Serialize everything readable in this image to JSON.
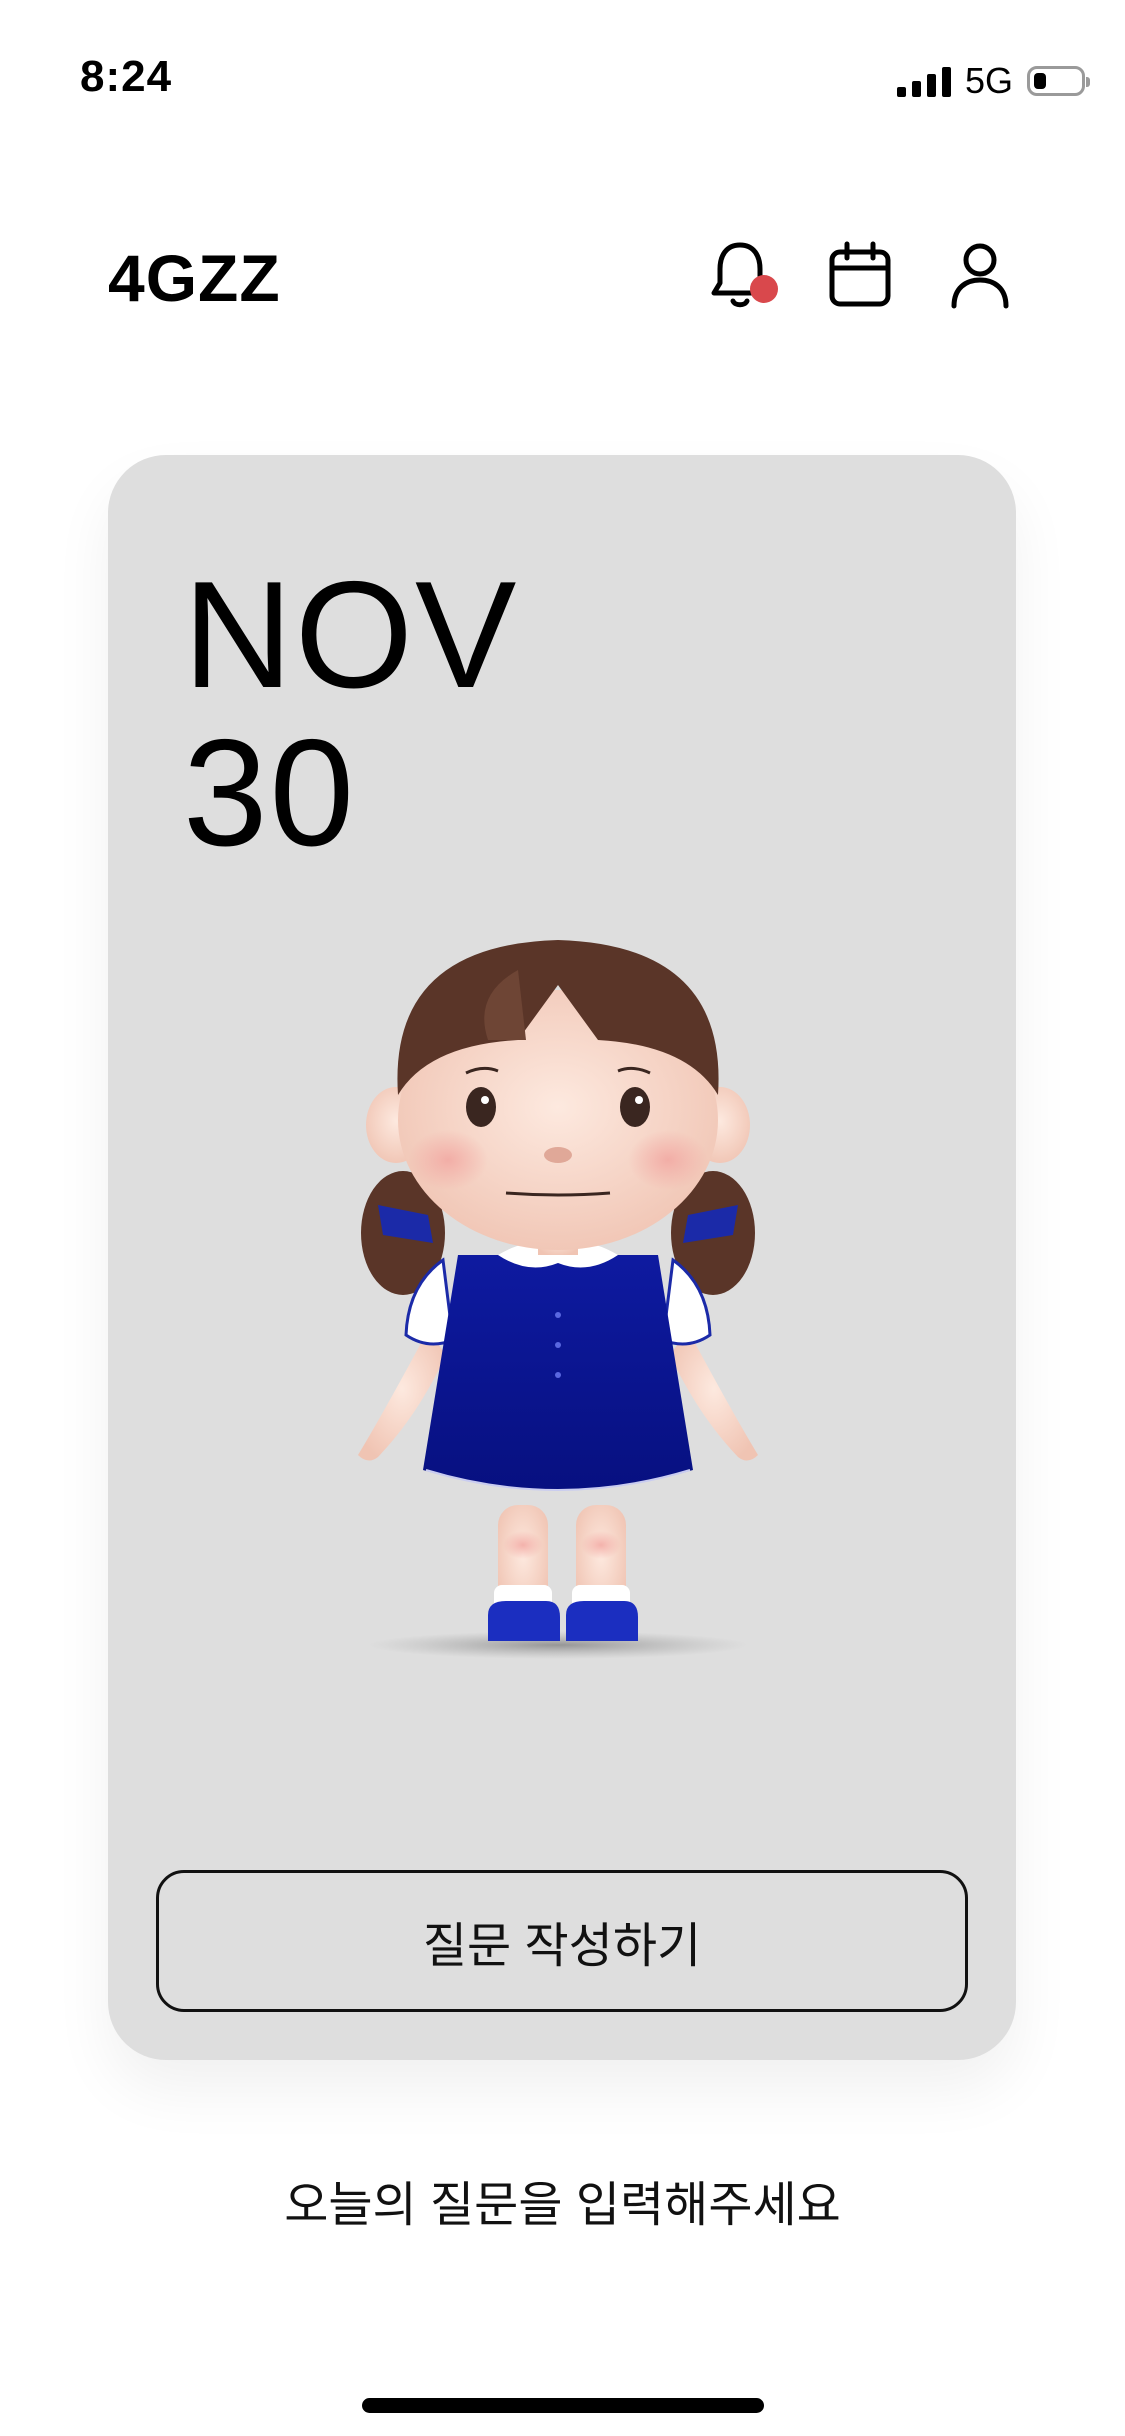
{
  "status_bar": {
    "time": "8:24",
    "network": "5G"
  },
  "header": {
    "logo": "4GZZ"
  },
  "icons": {
    "notification": "bell-icon",
    "calendar": "calendar-icon",
    "profile": "user-icon",
    "notification_dot_color": "#d9484c"
  },
  "card": {
    "month": "NOV",
    "day": "30",
    "button_label": "질문 작성하기"
  },
  "prompt_text": "오늘의 질문을 입력해주세요"
}
